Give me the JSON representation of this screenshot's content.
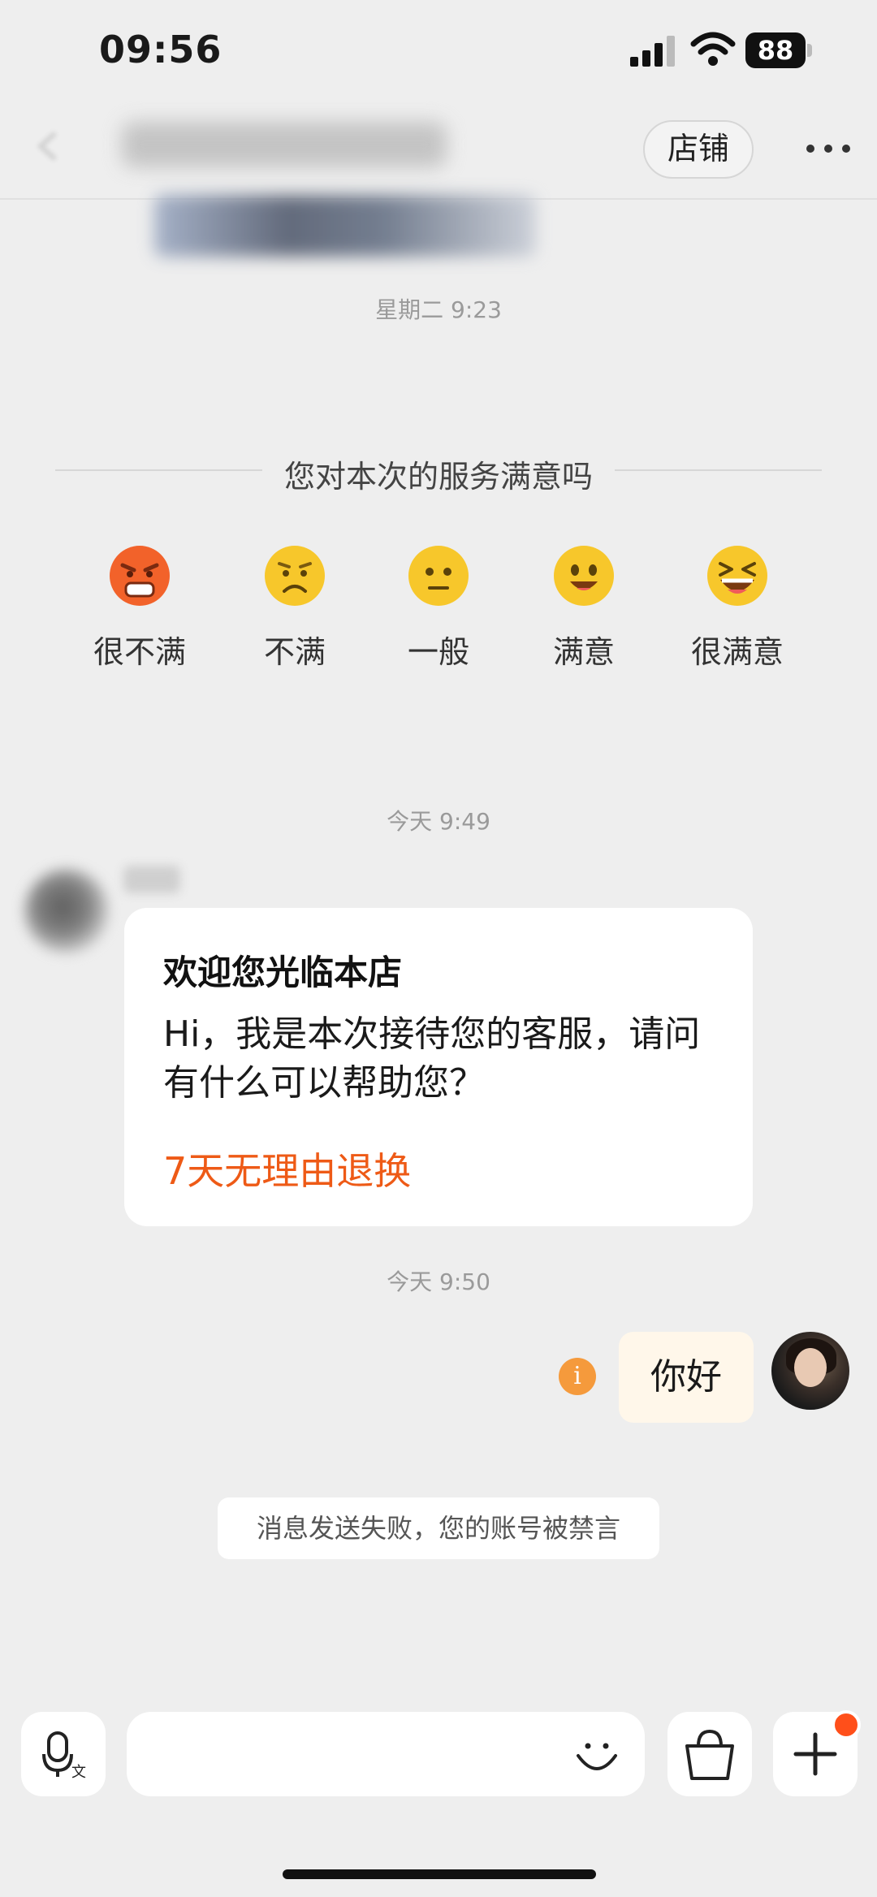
{
  "status_bar": {
    "time": "09:56",
    "battery": "88",
    "icons": [
      "signal-icon",
      "wifi-icon",
      "battery-icon"
    ]
  },
  "header": {
    "store_button_label": "店铺",
    "icons": [
      "back-icon",
      "more-icon"
    ]
  },
  "chat": {
    "timestamps": [
      "星期二 9:23",
      "今天 9:49",
      "今天 9:50"
    ],
    "survey": {
      "title": "您对本次的服务满意吗",
      "options": [
        {
          "label": "很不满",
          "icon": "very-unsatisfied-emoji-icon"
        },
        {
          "label": "不满",
          "icon": "unsatisfied-emoji-icon"
        },
        {
          "label": "一般",
          "icon": "neutral-emoji-icon"
        },
        {
          "label": "满意",
          "icon": "satisfied-emoji-icon"
        },
        {
          "label": "很满意",
          "icon": "very-satisfied-emoji-icon"
        }
      ]
    },
    "welcome_card": {
      "title": "欢迎您光临本店",
      "text": "Hi，我是本次接待您的客服，请问有什么可以帮助您？",
      "link": "7天无理由退换"
    },
    "outgoing_message": "你好",
    "failure_icon_text": "i",
    "system_notice": "消息发送失败，您的账号被禁言"
  },
  "input_bar": {
    "icons": [
      "voice-translate-icon",
      "emoji-icon",
      "shopping-bag-icon",
      "plus-icon"
    ]
  },
  "colors": {
    "background": "#eeeeee",
    "accent_link": "#ee5a16",
    "failure_icon": "#f59a3c",
    "notification_dot": "#ff4f1a",
    "outgoing_bubble": "#fff7ea"
  }
}
